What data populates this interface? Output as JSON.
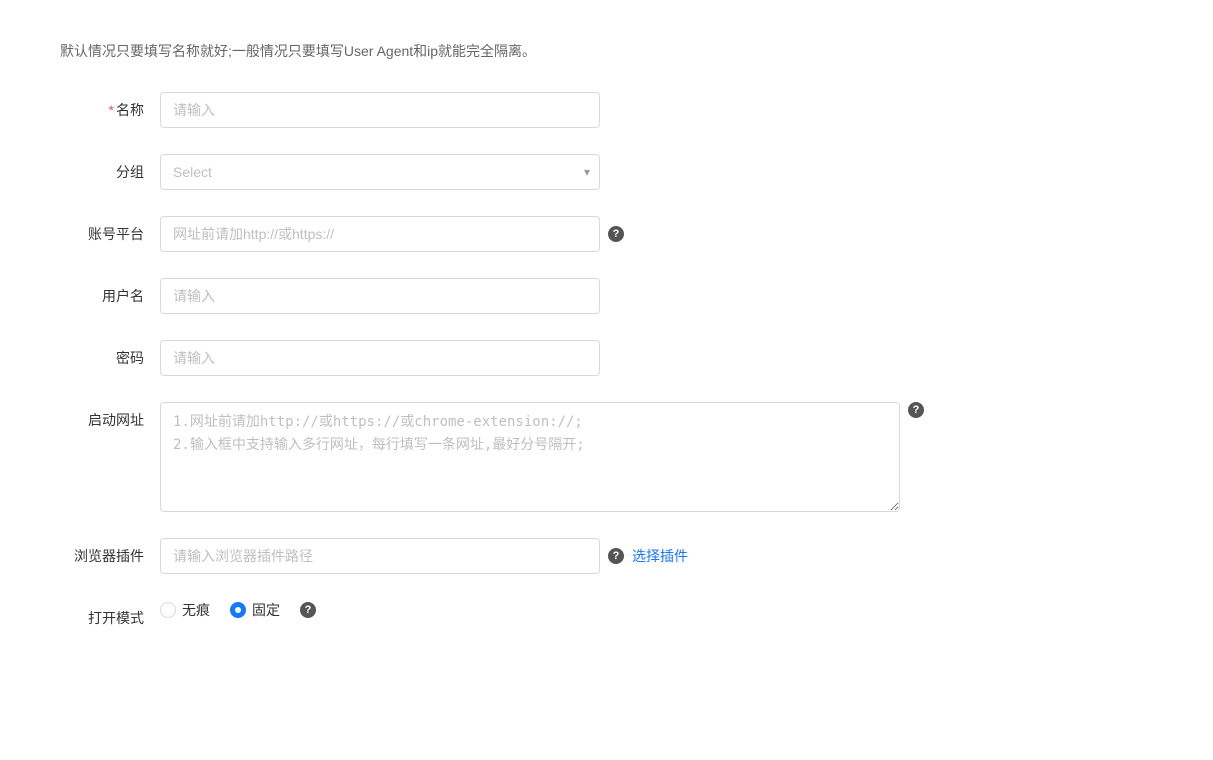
{
  "description": "默认情况只要填写名称就好;一般情况只要填写User Agent和ip就能完全隔离。",
  "form": {
    "name_label": "名称",
    "name_required": "*",
    "name_placeholder": "请输入",
    "group_label": "分组",
    "group_placeholder": "Select",
    "platform_label": "账号平台",
    "platform_placeholder": "网址前请加http://或https://",
    "username_label": "用户名",
    "username_placeholder": "请输入",
    "password_label": "密码",
    "password_placeholder": "请输入",
    "start_url_label": "启动网址",
    "start_url_placeholder": "1.网址前请加http://或https://或chrome-extension://;\n2.输入框中支持输入多行网址，每行填写一条网址,最好分号隔开;",
    "browser_plugin_label": "浏览器插件",
    "browser_plugin_placeholder": "请输入浏览器插件路径",
    "select_plugin_text": "选择插件",
    "open_mode_label": "打开模式",
    "radio_traceless": "无痕",
    "radio_fixed": "固定",
    "help_icon_text": "?",
    "mode_help_text": "?"
  }
}
